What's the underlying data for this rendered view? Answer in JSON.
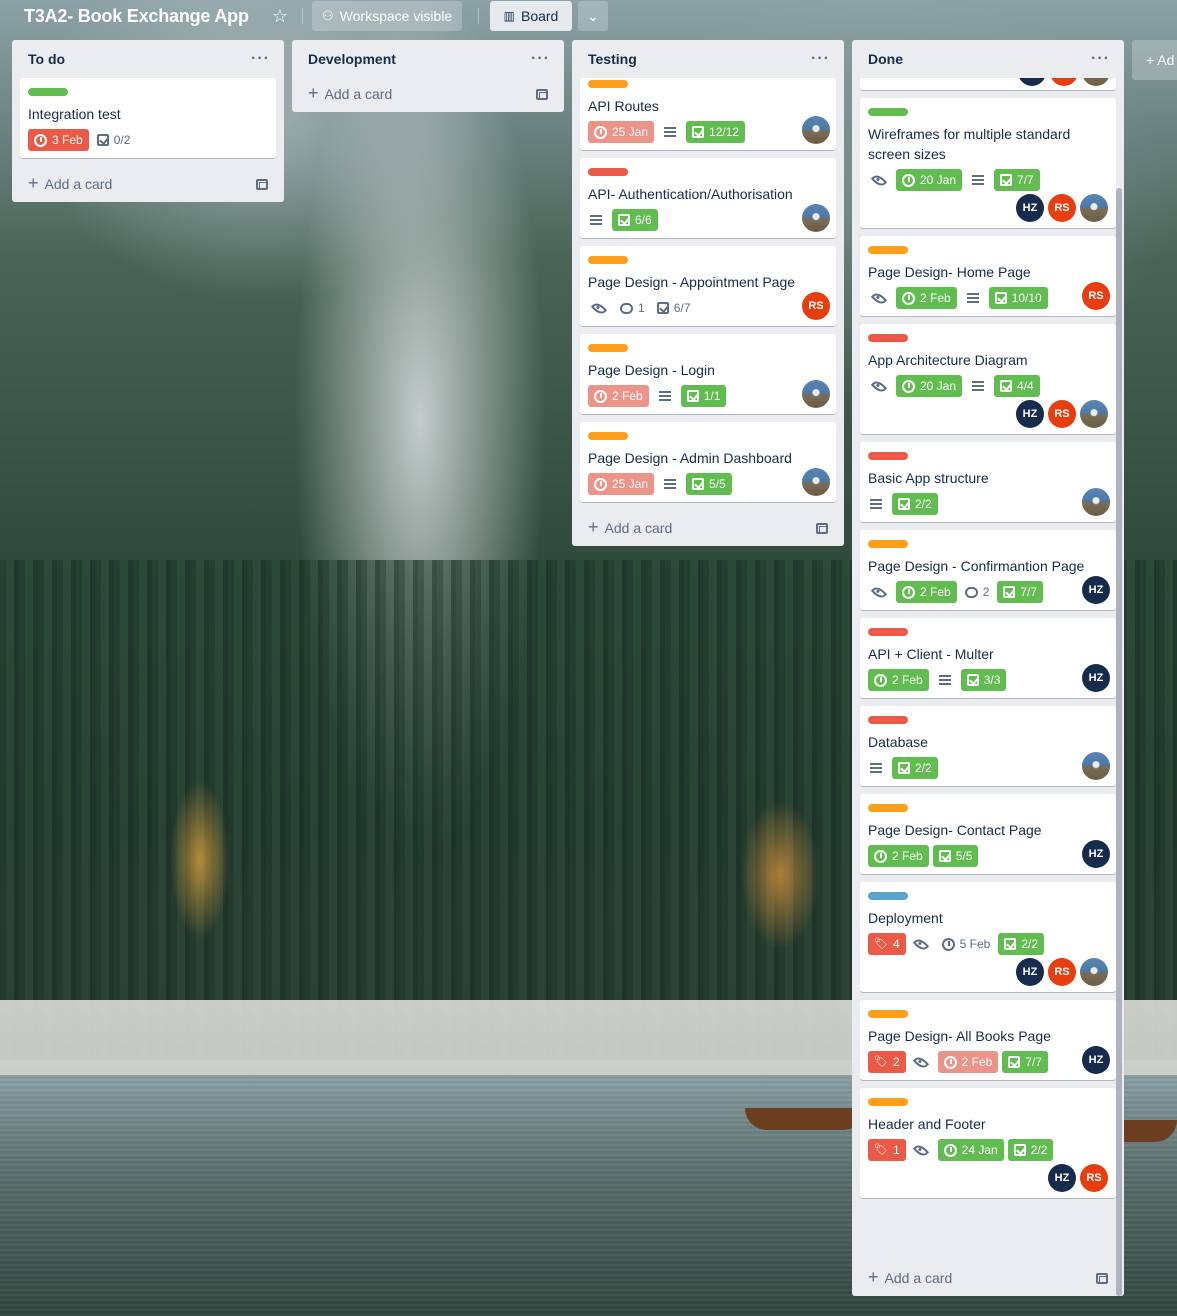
{
  "board": {
    "title": "T3A2- Book Exchange App",
    "visibility": "Workspace visible",
    "view": "Board",
    "add_list": "+ Ad"
  },
  "lists": {
    "todo": {
      "title": "To do",
      "add_card": "Add a card",
      "cards": [
        {
          "title": "Integration test",
          "label_color": "#61bd4f",
          "due": "3 Feb",
          "checklist": "0/2"
        }
      ]
    },
    "dev": {
      "title": "Development",
      "add_card": "Add a card"
    },
    "testing": {
      "title": "Testing",
      "add_card": "Add a card",
      "cards": [
        {
          "title": "API Routes",
          "label_color": "#ff9f1a",
          "due": "25 Jan",
          "checklist": "12/12"
        },
        {
          "title": "API- Authentication/Authorisation",
          "label_color": "#eb5a46",
          "checklist": "6/6"
        },
        {
          "title": "Page Design - Appointment Page",
          "label_color": "#ff9f1a",
          "comments": "1",
          "checklist": "6/7",
          "member": "RS"
        },
        {
          "title": "Page Design - Login",
          "label_color": "#ff9f1a",
          "due": "2 Feb",
          "checklist": "1/1"
        },
        {
          "title": "Page Design - Admin Dashboard",
          "label_color": "#ff9f1a",
          "due": "25 Jan",
          "checklist": "5/5"
        }
      ]
    },
    "done": {
      "title": "Done",
      "add_card": "Add a card",
      "members_hz": "HZ",
      "members_rs": "RS",
      "cards": [
        {
          "title": "Wireframes for multiple standard screen sizes",
          "label_color": "#61bd4f",
          "due": "20 Jan",
          "checklist": "7/7"
        },
        {
          "title": "Page Design- Home Page",
          "label_color": "#ff9f1a",
          "due": "2 Feb",
          "checklist": "10/10"
        },
        {
          "title": "App Architecture Diagram",
          "label_color": "#eb5a46",
          "due": "20 Jan",
          "checklist": "4/4"
        },
        {
          "title": "Basic App structure",
          "label_color": "#eb5a46",
          "checklist": "2/2"
        },
        {
          "title": "Page Design - Confirmantion Page",
          "label_color": "#ff9f1a",
          "due": "2 Feb",
          "comments": "2",
          "checklist": "7/7"
        },
        {
          "title": "API + Client - Multer",
          "label_color": "#eb5a46",
          "due": "2 Feb",
          "checklist": "3/3"
        },
        {
          "title": "Database",
          "label_color": "#eb5a46",
          "checklist": "2/2"
        },
        {
          "title": "Page Design- Contact Page",
          "label_color": "#ff9f1a",
          "due": "2 Feb",
          "checklist": "5/5"
        },
        {
          "title": "Deployment",
          "label_color": "#5ba4cf",
          "votes": "4",
          "due": "5 Feb",
          "checklist": "2/2"
        },
        {
          "title": "Page Design- All Books Page",
          "label_color": "#ff9f1a",
          "votes": "2",
          "due": "2 Feb",
          "checklist": "7/7"
        },
        {
          "title": "Header and Footer",
          "label_color": "#ff9f1a",
          "votes": "1",
          "due": "24 Jan",
          "checklist": "2/2"
        }
      ]
    }
  },
  "colors": {
    "green": "#61bd4f",
    "orange": "#ff9f1a",
    "red": "#eb5a46",
    "blue": "#5ba4cf",
    "list_bg": "#ebecf0"
  }
}
